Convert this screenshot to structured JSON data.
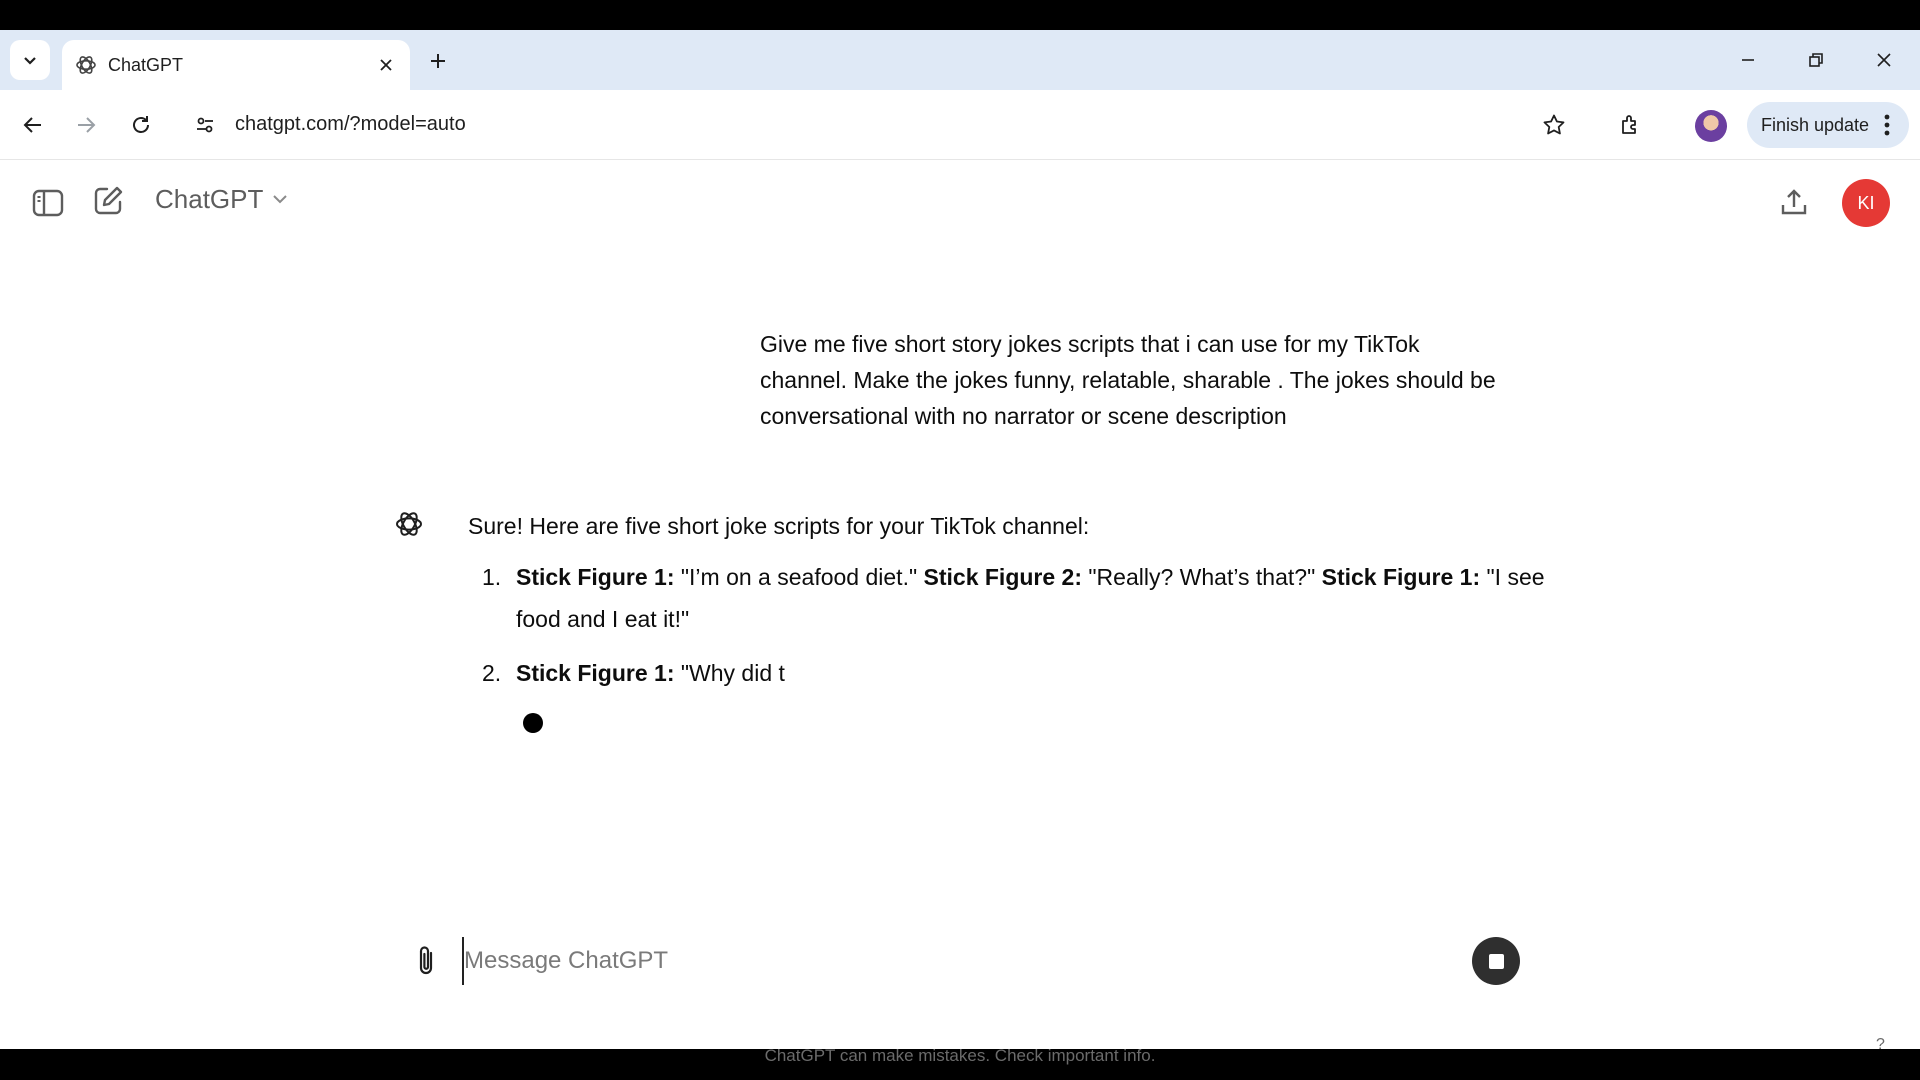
{
  "browser": {
    "tab": {
      "title": "ChatGPT"
    },
    "address": {
      "url": "chatgpt.com/?model=auto"
    },
    "finish_update_label": "Finish update"
  },
  "header": {
    "model_name": "ChatGPT",
    "user_initials": "KI"
  },
  "conversation": {
    "user_message": "Give me five short story jokes scripts that i can use for  my TikTok channel. Make the jokes funny, relatable, sharable . The jokes should be conversational with no narrator or scene description",
    "assistant_intro": "Sure! Here are five short joke scripts for your TikTok channel:",
    "items": [
      {
        "number": "1.",
        "s1": "Stick Figure 1:",
        "t1": " \"I’m on a seafood diet.\" ",
        "s2": "Stick Figure 2:",
        "t2": " \"Really? What’s that?\" ",
        "s3": "Stick Figure 1:",
        "t3": " \"I see food and I eat it!\""
      },
      {
        "number": "2.",
        "s1": "Stick Figure 1:",
        "t1": " \"Why did t"
      }
    ]
  },
  "composer": {
    "placeholder": "Message ChatGPT"
  },
  "footer": {
    "disclaimer": "ChatGPT can make mistakes. Check important info.",
    "help": "?"
  },
  "icons": [
    "tab-search-icon",
    "openai-logo-icon",
    "close-icon",
    "plus-icon",
    "minimize-icon",
    "restore-icon",
    "back-icon",
    "forward-icon",
    "reload-icon",
    "site-settings-icon",
    "star-icon",
    "extensions-icon",
    "kebab-icon",
    "sidebar-toggle-icon",
    "new-chat-icon",
    "chevron-down-icon",
    "share-icon",
    "paperclip-icon",
    "stop-icon"
  ]
}
